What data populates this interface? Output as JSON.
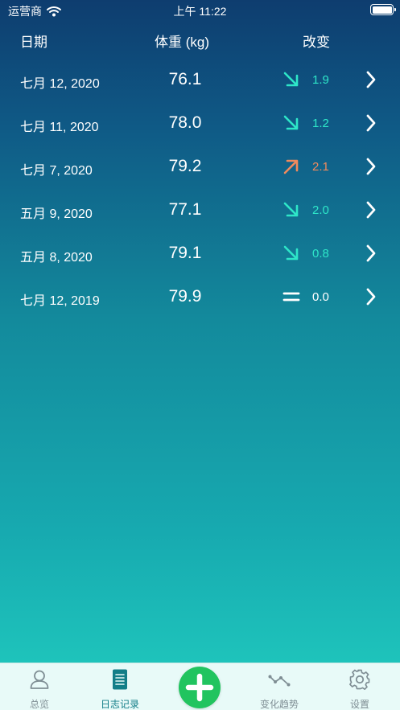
{
  "status_bar": {
    "carrier": "运营商",
    "time": "上午 11:22"
  },
  "header": {
    "date": "日期",
    "weight": "体重 (kg)",
    "change": "改变"
  },
  "entries": [
    {
      "date": "七月 12, 2020",
      "weight": "76.1",
      "trend": "down",
      "delta": "1.9",
      "color": "#2ee6c8"
    },
    {
      "date": "七月 11, 2020",
      "weight": "78.0",
      "trend": "down",
      "delta": "1.2",
      "color": "#2ee6c8"
    },
    {
      "date": "七月 7, 2020",
      "weight": "79.2",
      "trend": "up",
      "delta": "2.1",
      "color": "#f08a5d"
    },
    {
      "date": "五月 9, 2020",
      "weight": "77.1",
      "trend": "down",
      "delta": "2.0",
      "color": "#2ee6c8"
    },
    {
      "date": "五月 8, 2020",
      "weight": "79.1",
      "trend": "down",
      "delta": "0.8",
      "color": "#2ee6c8"
    },
    {
      "date": "七月 12, 2019",
      "weight": "79.9",
      "trend": "equal",
      "delta": "0.0",
      "color": "#ffffff"
    }
  ],
  "tabbar": {
    "overview": "总览",
    "log": "日志记录",
    "trend": "变化趋势",
    "settings": "设置"
  },
  "colors": {
    "accent": "#137e88",
    "add_button": "#21c45f",
    "down_trend": "#2ee6c8",
    "up_trend": "#f08a5d"
  }
}
